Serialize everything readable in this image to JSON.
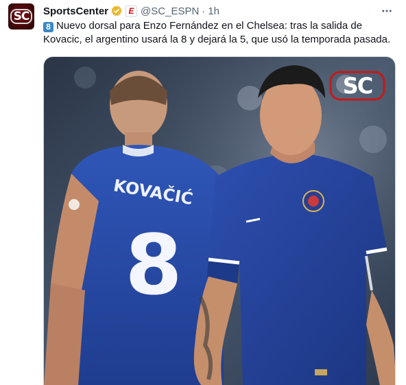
{
  "account": {
    "display_name": "SportsCenter",
    "handle": "@SC_ESPN",
    "separator": "·",
    "time": "1h",
    "avatar_logo": "SC",
    "affiliate_badge": "E",
    "verified_badge_color": "#e8b92f"
  },
  "tweet": {
    "number_emoji": "8",
    "text": "Nuevo dorsal para Enzo Fernández en el Chelsea: tras la salida de Kovacic, el argentino usará la 8 y dejará la 5, que usó la temporada pasada."
  },
  "media": {
    "watermark": "SC",
    "jersey_name": "KOVAČIĆ",
    "jersey_number": "8",
    "kit_color": "#2f56b8"
  },
  "actions": {
    "more_icon": "more-horizontal-icon"
  }
}
